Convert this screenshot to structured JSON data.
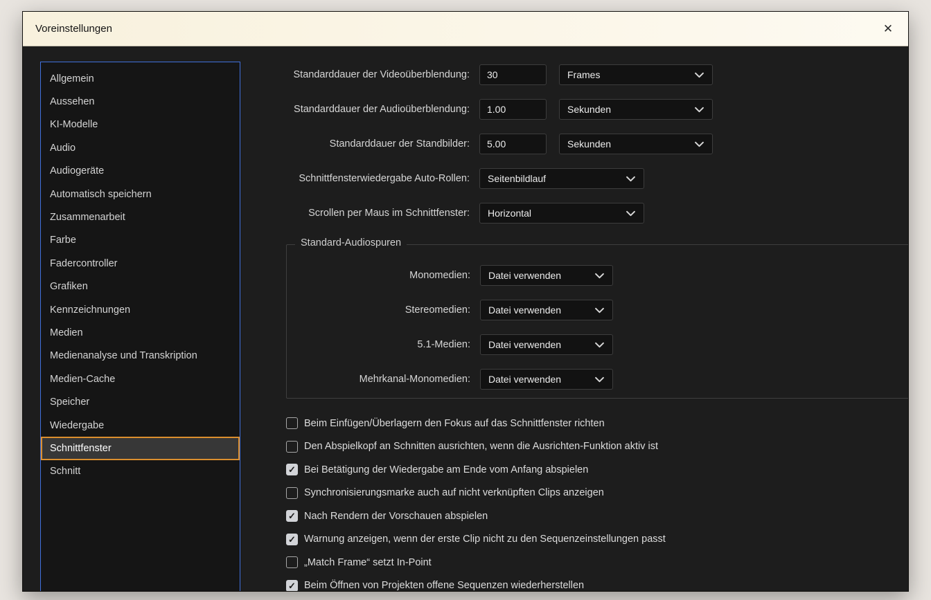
{
  "dialog": {
    "title": "Voreinstellungen",
    "close_glyph": "✕"
  },
  "colors": {
    "accent_orange": "#dc8f2e",
    "focus_blue": "#4070dd",
    "panel_dark": "#1d1d1d",
    "titlebar_cream": "#f8f1dd"
  },
  "sidebar": {
    "items": [
      {
        "label": "Allgemein",
        "selected": false
      },
      {
        "label": "Aussehen",
        "selected": false
      },
      {
        "label": "KI-Modelle",
        "selected": false
      },
      {
        "label": "Audio",
        "selected": false
      },
      {
        "label": "Audiogeräte",
        "selected": false
      },
      {
        "label": "Automatisch speichern",
        "selected": false
      },
      {
        "label": "Zusammenarbeit",
        "selected": false
      },
      {
        "label": "Farbe",
        "selected": false
      },
      {
        "label": "Fadercontroller",
        "selected": false
      },
      {
        "label": "Grafiken",
        "selected": false
      },
      {
        "label": "Kennzeichnungen",
        "selected": false
      },
      {
        "label": "Medien",
        "selected": false
      },
      {
        "label": "Medienanalyse und Transkription",
        "selected": false
      },
      {
        "label": "Medien-Cache",
        "selected": false
      },
      {
        "label": "Speicher",
        "selected": false
      },
      {
        "label": "Wiedergabe",
        "selected": false
      },
      {
        "label": "Schnittfenster",
        "selected": true
      },
      {
        "label": "Schnitt",
        "selected": false
      }
    ]
  },
  "main": {
    "duration_rows": [
      {
        "label": "Standarddauer der Videoüberblendung:",
        "value": "30",
        "unit": "Frames"
      },
      {
        "label": "Standarddauer der Audioüberblendung:",
        "value": "1.00",
        "unit": "Sekunden"
      },
      {
        "label": "Standarddauer der Standbilder:",
        "value": "5.00",
        "unit": "Sekunden"
      }
    ],
    "select_rows": [
      {
        "label": "Schnittfensterwiedergabe Auto-Rollen:",
        "value": "Seitenbildlauf"
      },
      {
        "label": "Scrollen per Maus im Schnittfenster:",
        "value": "Horizontal"
      }
    ],
    "audio_tracks": {
      "legend": "Standard-Audiospuren",
      "rows": [
        {
          "label": "Monomedien:",
          "value": "Datei verwenden"
        },
        {
          "label": "Stereomedien:",
          "value": "Datei verwenden"
        },
        {
          "label": "5.1-Medien:",
          "value": "Datei verwenden"
        },
        {
          "label": "Mehrkanal-Monomedien:",
          "value": "Datei verwenden"
        }
      ]
    },
    "checkboxes": [
      {
        "label": "Beim Einfügen/Überlagern den Fokus auf das Schnittfenster richten",
        "checked": false
      },
      {
        "label": "Den Abspielkopf an Schnitten ausrichten, wenn die Ausrichten-Funktion aktiv ist",
        "checked": false
      },
      {
        "label": "Bei Betätigung der Wiedergabe am Ende vom Anfang abspielen",
        "checked": true
      },
      {
        "label": "Synchronisierungsmarke auch auf nicht verknüpften Clips anzeigen",
        "checked": false
      },
      {
        "label": "Nach Rendern der Vorschauen abspielen",
        "checked": true
      },
      {
        "label": "Warnung anzeigen, wenn der erste Clip nicht zu den Sequenzeinstellungen passt",
        "checked": true
      },
      {
        "label": "„Match Frame“ setzt In-Point",
        "checked": false
      },
      {
        "label": "Beim Öffnen von Projekten offene Sequenzen wiederherstellen",
        "checked": true
      }
    ]
  }
}
